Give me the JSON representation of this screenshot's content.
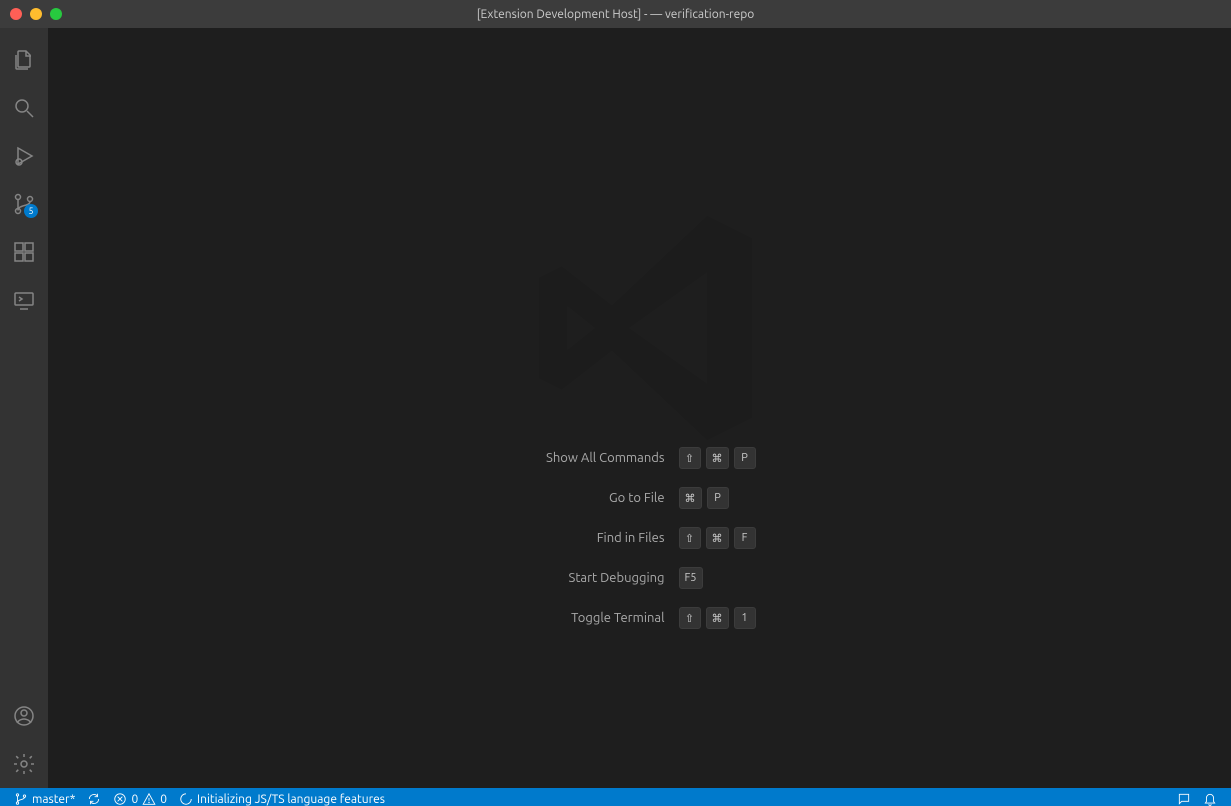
{
  "titlebar": {
    "title": "[Extension Development Host] - — verification-repo"
  },
  "activitybar": {
    "scm_badge": "5"
  },
  "shortcuts": {
    "rows": [
      {
        "label": "Show All Commands",
        "k0": "⇧",
        "k1": "⌘",
        "k2": "P"
      },
      {
        "label": "Go to File",
        "k0": "⌘",
        "k1": "P"
      },
      {
        "label": "Find in Files",
        "k0": "⇧",
        "k1": "⌘",
        "k2": "F"
      },
      {
        "label": "Start Debugging",
        "k0": "F5"
      },
      {
        "label": "Toggle Terminal",
        "k0": "⇧",
        "k1": "⌘",
        "k2": "1"
      }
    ]
  },
  "statusbar": {
    "branch": "master*",
    "errors": "0",
    "warnings": "0",
    "language_status": "Initializing JS/TS language features"
  }
}
